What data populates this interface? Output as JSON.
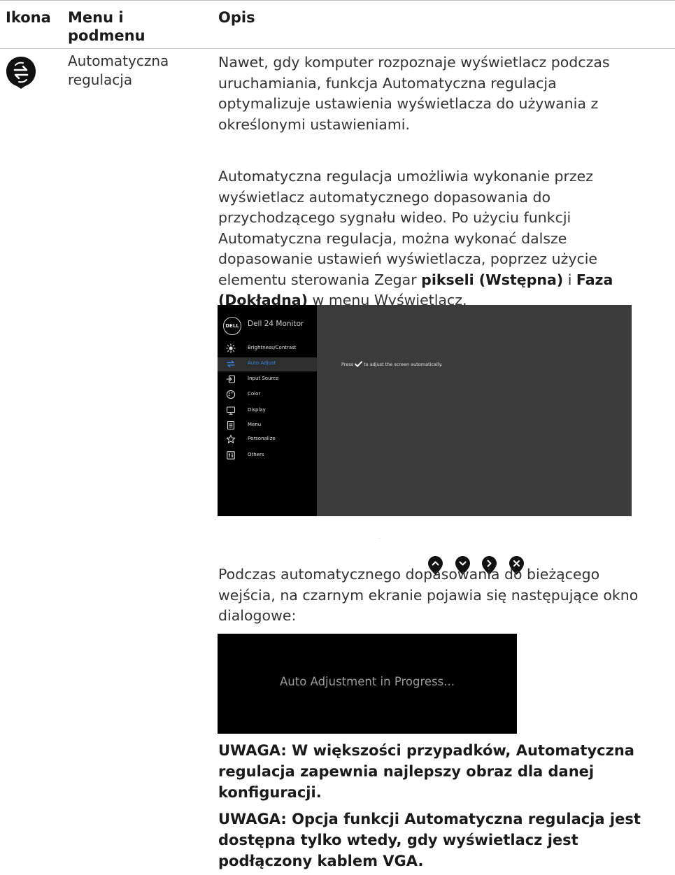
{
  "header": {
    "icon_col": "Ikona",
    "menu_col": "Menu i podmenu",
    "desc_col": "Opis"
  },
  "row": {
    "icon": "auto-adjust-icon",
    "menu_name": "Automatyczna regulacja",
    "para1": "Nawet, gdy komputer rozpoznaje wyświetlacz podczas uruchamiania, funkcja Automatyczna regulacja optymalizuje ustawienia wyświetlacza do używania z określonymi ustawieniami.",
    "para2_a": "Automatyczna regulacja umożliwia wykonanie przez wyświetlacz automatycznego dopasowania do przychodzącego sygnału wideo. Po użyciu funkcji Automatyczna regulacja, można wykonać dalsze dopasowanie ustawień wyświetlacza, poprzez użycie elementu sterowania Zegar ",
    "para2_b1": "pikseli (Wstępna)",
    "para2_c": " i ",
    "para2_b2": "Faza (Dokładna)",
    "para2_d": " w menu Wyświetlacz.",
    "para3": "Podczas automatycznego dopasowania do bieżącego wejścia, na czarnym ekranie pojawia się następujące okno dialogowe:",
    "note1": "UWAGA: W większości przypadków, Automatyczna regulacja zapewnia najlepszy obraz dla danej konfiguracji.",
    "note2": "UWAGA: Opcja funkcji Automatyczna regulacja jest dostępna tylko wtedy, gdy wyświetlacz jest podłączony kablem VGA."
  },
  "osd": {
    "logo": "DELL",
    "title": "Dell 24 Monitor",
    "items": [
      {
        "label": "Brightness/Contrast",
        "icon": "brightness-icon"
      },
      {
        "label": "Auto Adjust",
        "icon": "auto-adjust-icon",
        "active": true
      },
      {
        "label": "Input Source",
        "icon": "input-source-icon"
      },
      {
        "label": "Color",
        "icon": "color-icon"
      },
      {
        "label": "Display",
        "icon": "display-icon"
      },
      {
        "label": "Menu",
        "icon": "menu-icon"
      },
      {
        "label": "Personalize",
        "icon": "star-icon"
      },
      {
        "label": "Others",
        "icon": "others-icon"
      }
    ],
    "msg_before": "Press",
    "msg_after": "to adjust the screen automatically.",
    "highlight_color": "#2f86e6"
  },
  "nav_buttons": [
    "up-icon",
    "down-icon",
    "right-icon",
    "close-icon"
  ],
  "dialog": {
    "text": "Auto Adjustment in Progress..."
  }
}
